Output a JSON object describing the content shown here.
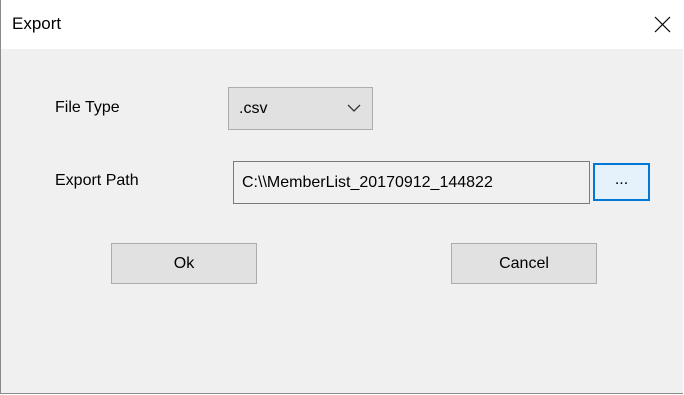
{
  "window": {
    "title": "Export",
    "close_icon": "close-icon"
  },
  "form": {
    "file_type_label": "File Type",
    "file_type_value": ".csv",
    "export_path_label": "Export Path",
    "export_path_value": "C:\\\\MemberList_20170912_144822",
    "browse_label": "..."
  },
  "buttons": {
    "ok": "Ok",
    "cancel": "Cancel"
  }
}
